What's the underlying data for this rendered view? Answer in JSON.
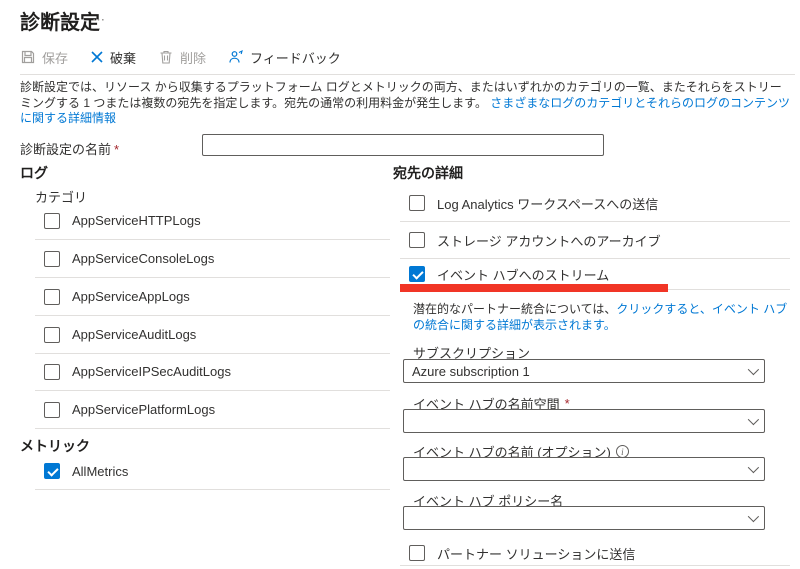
{
  "page": {
    "title": "診断設定",
    "ellipsis": "⋯"
  },
  "toolbar": {
    "save": {
      "label": "保存",
      "enabled": false
    },
    "discard": {
      "label": "破棄",
      "enabled": true
    },
    "delete": {
      "label": "削除",
      "enabled": false
    },
    "feedback": {
      "label": "フィードバック",
      "enabled": true
    }
  },
  "description": {
    "text": "診断設定では、リソース から収集するプラットフォーム ログとメトリックの両方、またはいずれかのカテゴリの一覧、またそれらをストリーミングする 1 つまたは複数の宛先を指定します。宛先の通常の利用料金が発生します。",
    "link": "さまざまなログのカテゴリとそれらのログのコンテンツに関する詳細情報"
  },
  "name_field": {
    "label": "診断設定の名前",
    "required_mark": "*",
    "value": ""
  },
  "logs": {
    "header": "ログ",
    "category_label": "カテゴリ",
    "items": [
      {
        "label": "AppServiceHTTPLogs",
        "checked": false
      },
      {
        "label": "AppServiceConsoleLogs",
        "checked": false
      },
      {
        "label": "AppServiceAppLogs",
        "checked": false
      },
      {
        "label": "AppServiceAuditLogs",
        "checked": false
      },
      {
        "label": "AppServiceIPSecAuditLogs",
        "checked": false
      },
      {
        "label": "AppServicePlatformLogs",
        "checked": false
      }
    ]
  },
  "metrics": {
    "header": "メトリック",
    "items": [
      {
        "label": "AllMetrics",
        "checked": true
      }
    ]
  },
  "destination": {
    "header": "宛先の詳細",
    "options": [
      {
        "label": "Log Analytics ワークスペースへの送信",
        "checked": false
      },
      {
        "label": "ストレージ アカウントへのアーカイブ",
        "checked": false
      },
      {
        "label": "イベント ハブへのストリーム",
        "checked": true,
        "highlighted": true
      }
    ],
    "partner_note": {
      "text": "潜在的なパートナー統合については、",
      "link": "クリックすると、イベント ハブの統合に関する詳細が表示されます。"
    },
    "fields": [
      {
        "label": "サブスクリプション",
        "value": "Azure subscription 1"
      },
      {
        "label": "イベント ハブの名前空間",
        "required_mark": "*",
        "value": ""
      },
      {
        "label": "イベント ハブの名前 (オプション)",
        "has_info": true,
        "value": ""
      },
      {
        "label": "イベント ハブ ポリシー名",
        "value": ""
      }
    ],
    "partner_solution": {
      "label": "パートナー ソリューションに送信",
      "checked": false
    }
  },
  "colors": {
    "accent": "#0078d4",
    "highlight_red": "#f13526",
    "required_red": "#a4262c",
    "divider": "#e1dfdd",
    "disabled_text": "#a19f9d"
  }
}
